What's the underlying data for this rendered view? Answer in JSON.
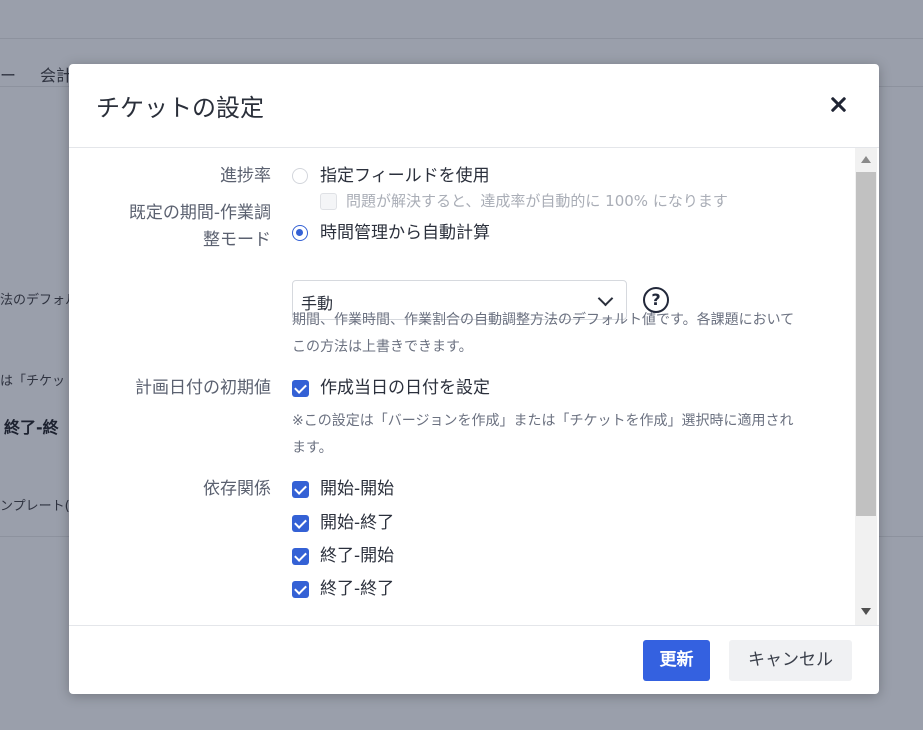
{
  "background": {
    "tabs": [
      "ー",
      "会計"
    ],
    "fragments": [
      "法のデフォル",
      "は「チケッ",
      "終了-終",
      "ンプレート("
    ]
  },
  "modal": {
    "title": "チケットの設定",
    "progress": {
      "label": "進捗率",
      "option_field": "指定フィールドを使用",
      "sub_option": "問題が解決すると、達成率が自動的に 100% になります",
      "option_auto": "時間管理から自動計算"
    },
    "period_mode": {
      "label_line1": "既定の期間-作業調",
      "label_line2": "整モード",
      "selected": "手動",
      "help_glyph": "?",
      "hint_line1": "期間、作業時間、作業割合の自動調整方法のデフォルト値です。各課題において",
      "hint_line2": "この方法は上書きできます。"
    },
    "plan_date": {
      "label": "計画日付の初期値",
      "option": "作成当日の日付を設定",
      "hint_line1": "※この設定は「バージョンを作成」または「チケットを作成」選択時に適用され",
      "hint_line2": "ます。"
    },
    "dependency": {
      "label": "依存関係",
      "options": [
        "開始-開始",
        "開始-終了",
        "終了-開始",
        "終了-終了"
      ]
    },
    "buttons": {
      "update": "更新",
      "cancel": "キャンセル"
    }
  },
  "colors": {
    "accent": "#3461d5",
    "overlay": "#9a9fab"
  }
}
